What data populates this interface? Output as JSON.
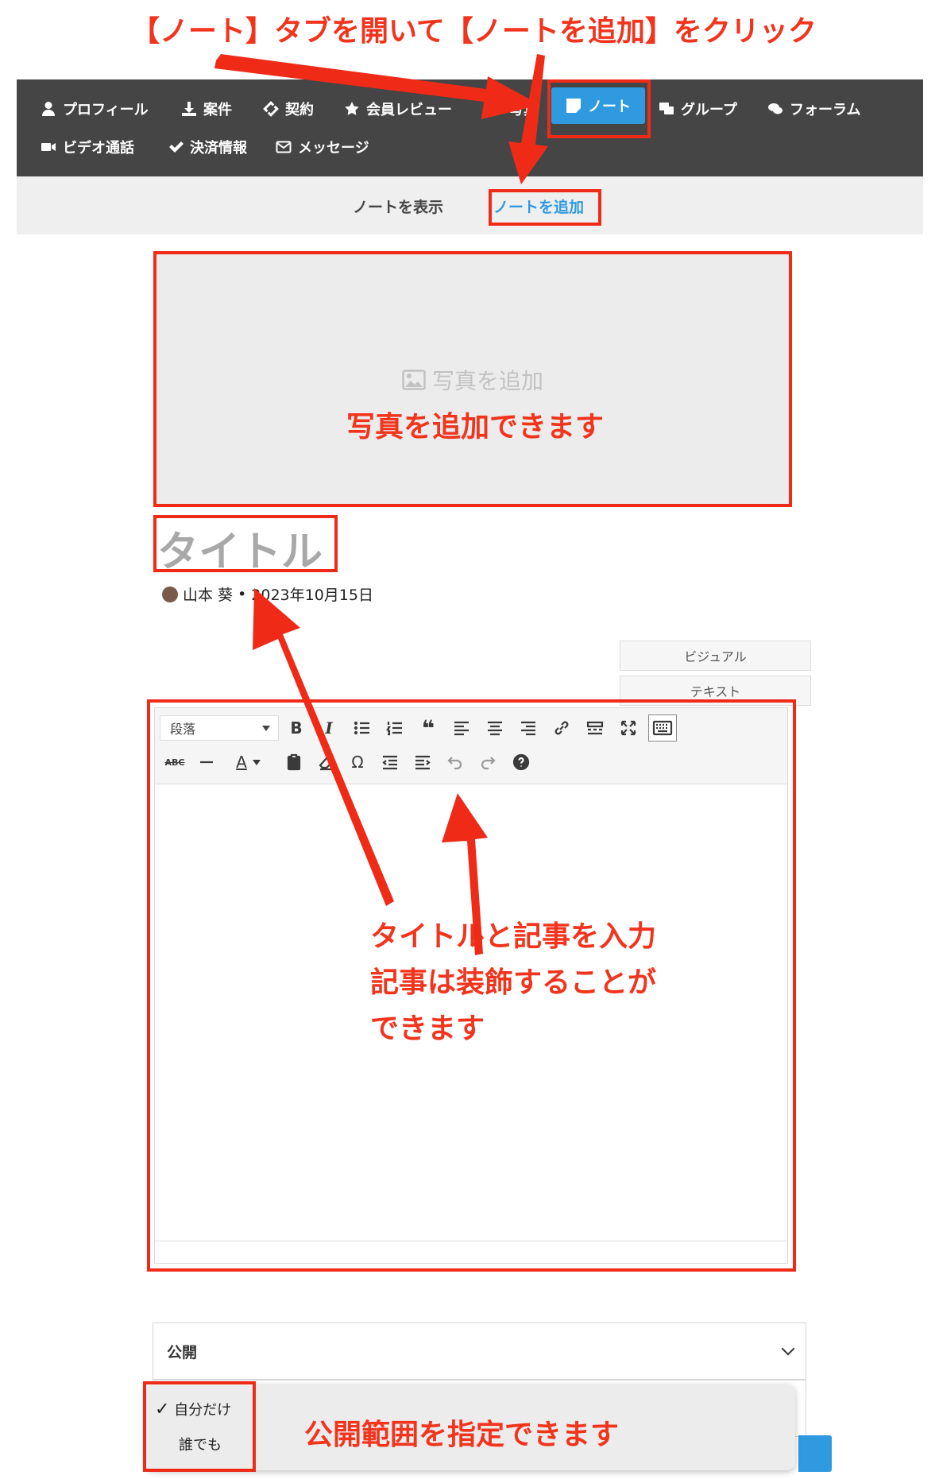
{
  "instruction": {
    "top": "【ノート】タブを開いて【ノートを追加】をクリック"
  },
  "nav": {
    "row1": [
      {
        "label": "プロフィール",
        "icon": "user-icon"
      },
      {
        "label": "案件",
        "icon": "download-icon"
      },
      {
        "label": "契約",
        "icon": "link-icon"
      },
      {
        "label": "会員レビュー",
        "icon": "star-icon"
      },
      {
        "label": "写真",
        "icon": "image-icon"
      },
      {
        "label": "ノート",
        "icon": "note-icon",
        "active": true
      },
      {
        "label": "グループ",
        "icon": "group-icon"
      },
      {
        "label": "フォーラム",
        "icon": "comments-icon"
      }
    ],
    "row2": [
      {
        "label": "ビデオ通話",
        "icon": "video-icon"
      },
      {
        "label": "決済情報",
        "icon": "check-icon"
      },
      {
        "label": "メッセージ",
        "icon": "envelope-icon"
      }
    ],
    "active_color": "#2f9ae0"
  },
  "subnav": {
    "view_notes": "ノートを表示",
    "add_note": "ノートを追加"
  },
  "photo": {
    "placeholder": "写真を追加",
    "annotation": "写真を追加できます"
  },
  "post": {
    "title_placeholder": "タイトル",
    "author": "山本 葵",
    "separator": "•",
    "date": "2023年10月15日"
  },
  "editor": {
    "mode_visual": "ビジュアル",
    "mode_text": "テキスト",
    "format_select": "段落",
    "annotation_lines": [
      "タイトルと記事を入力",
      "記事は装飾することが",
      "できます"
    ]
  },
  "visibility": {
    "label": "公開",
    "options": [
      "自分だけ",
      "誰でも"
    ],
    "selected": "自分だけ",
    "annotation": "公開範囲を指定できます"
  },
  "annotation_color": "#ef2b18"
}
